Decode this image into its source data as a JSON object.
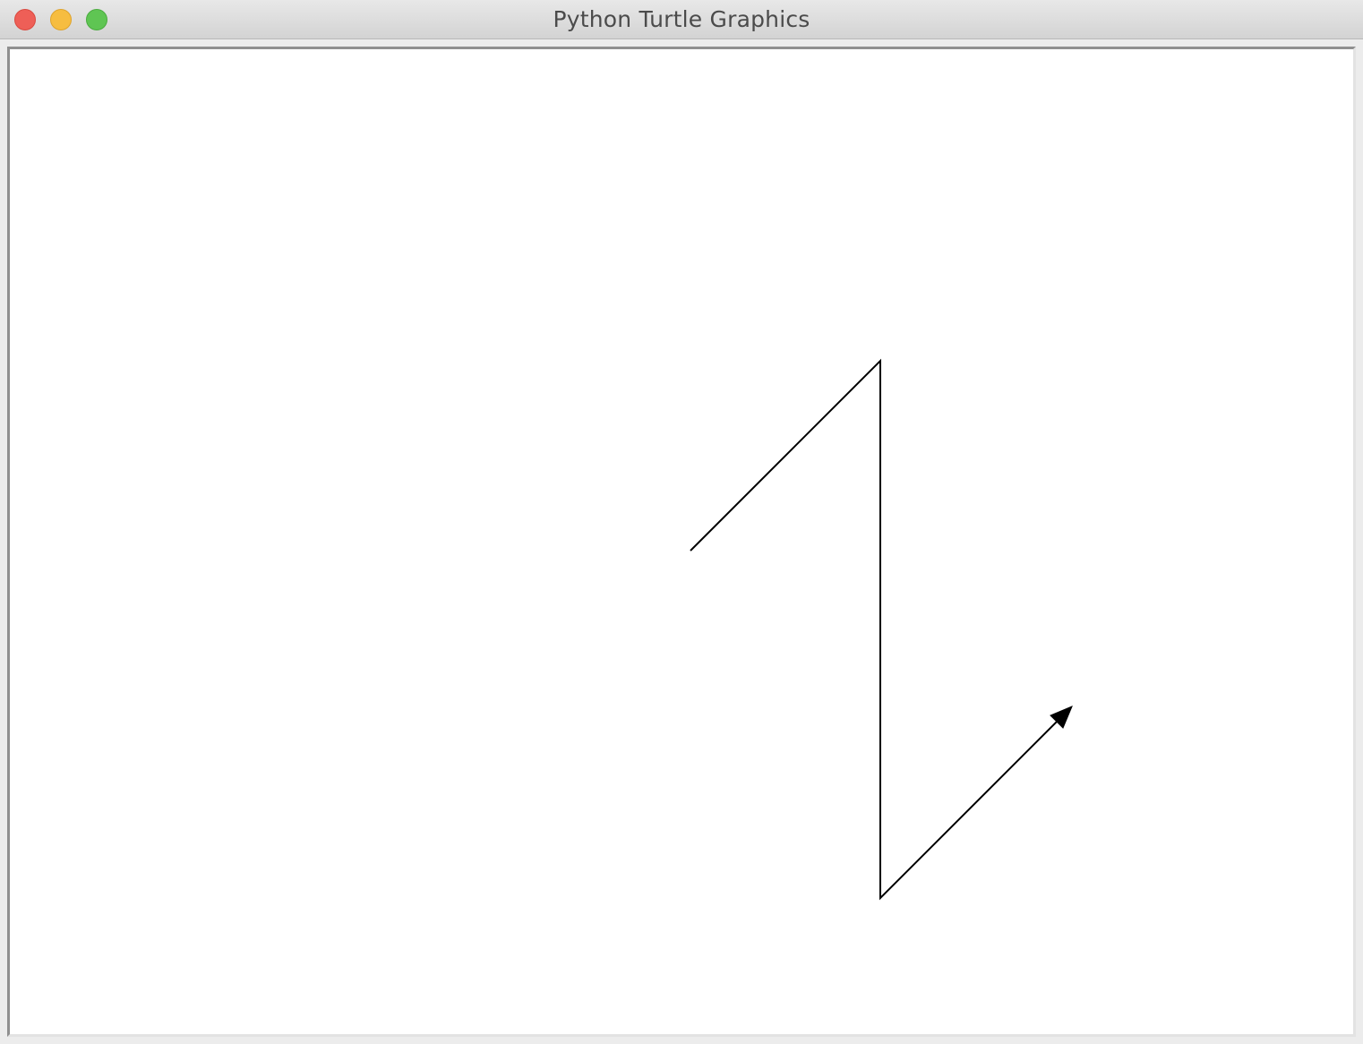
{
  "window": {
    "title": "Python Turtle Graphics"
  },
  "controls": {
    "close": "close-icon",
    "minimize": "minimize-icon",
    "maximize": "maximize-icon"
  },
  "colors": {
    "pen": "#000000",
    "canvas_background": "#ffffff"
  }
}
